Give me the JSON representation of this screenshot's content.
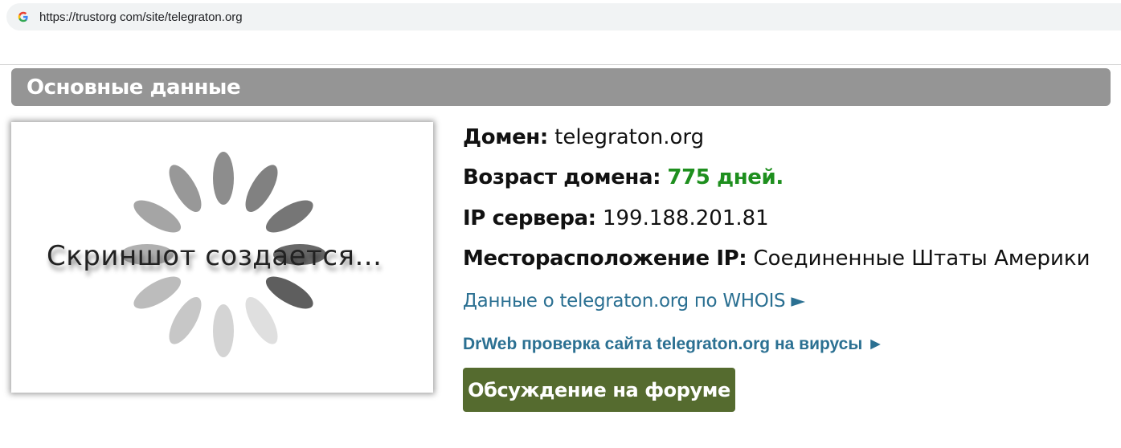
{
  "browser": {
    "url": "https://trustorg com/site/telegraton.org",
    "site_icon": "google-g-icon"
  },
  "section": {
    "title": "Основные данные"
  },
  "screenshot": {
    "placeholder_text": "Скриншот создается...",
    "icon": "loading-spinner-icon"
  },
  "info": {
    "domain_label": "Домен:",
    "domain_value": "telegraton.org",
    "age_label": "Возраст домена:",
    "age_value": "775 дней.",
    "ip_label": "IP сервера:",
    "ip_value": "199.188.201.81",
    "location_label": "Месторасположение IP:",
    "location_value": "Соединенные Штаты Америки"
  },
  "links": {
    "whois": "Данные о telegraton.org по WHOIS ►",
    "drweb": "DrWeb проверка сайта telegraton.org на вирусы ►"
  },
  "forum_button": {
    "label": "Обсуждение на форуме"
  },
  "colors": {
    "header_bg": "#959595",
    "link": "#2b7092",
    "age_green": "#1e8f1e",
    "forum_button_bg": "#556b2f"
  }
}
